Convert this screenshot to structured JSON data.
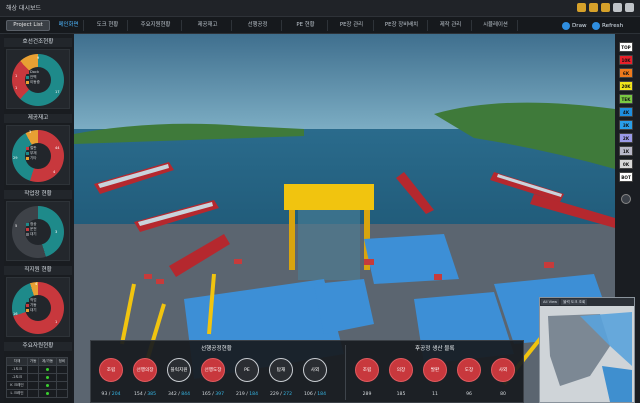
{
  "app": {
    "title": "해상 대시보드"
  },
  "nav": {
    "project_button": "Project List",
    "tabs": [
      "메인화면",
      "도크 현황",
      "주요지원현황",
      "제공재고",
      "선행공정",
      "PE 현황",
      "PE장 관리",
      "PE장 장비배치",
      "제작 관리",
      "시뮬레이션"
    ],
    "active_tab_index": 0,
    "draw_label": "Draw",
    "refresh_label": "Refresh"
  },
  "left_panels": {
    "p1": {
      "title": "호선건조현황",
      "legend": [
        "Dock",
        "안벽",
        "이동중"
      ],
      "values": [
        "1",
        "9",
        "1",
        "17"
      ]
    },
    "p2": {
      "title": "제공재고",
      "legend": [
        "철판",
        "부재",
        "기타"
      ],
      "values": [
        "3",
        "44",
        "29",
        "4"
      ]
    },
    "p3": {
      "title": "작업장 현황",
      "legend": [
        "정상",
        "운전",
        "대기"
      ],
      "values": [
        "5",
        "3"
      ]
    },
    "p4": {
      "title": "직지원 현황",
      "legend": [
        "작업",
        "가동",
        "대기"
      ],
      "values": [
        "4",
        "16",
        "1"
      ]
    },
    "table": {
      "title": "주요자원현황",
      "headers": [
        "자재",
        "가동",
        "계/가동",
        "정비"
      ],
      "rows": [
        [
          "-1도크",
          "",
          "",
          ""
        ],
        [
          "-2도크",
          "",
          "",
          ""
        ],
        [
          "K 크레인",
          "",
          "",
          ""
        ],
        [
          "L 크레인",
          "",
          "",
          ""
        ],
        [
          "골리앗",
          "",
          "",
          ""
        ]
      ]
    }
  },
  "levels": [
    "TOP",
    "10K",
    "6K",
    "20K",
    "TEK",
    "4K",
    "3K",
    "2K",
    "1K",
    "0K",
    "BOT"
  ],
  "level_colors": [
    "#ffffff",
    "#e8202a",
    "#f07a1c",
    "#f2e41c",
    "#7ac943",
    "#1e8fe0",
    "#2a9fe8",
    "#9a9ae8",
    "#b8b8c8",
    "#d8d8d8",
    "#ffffff"
  ],
  "bottom": {
    "left": {
      "title": "선행공정현황",
      "items": [
        {
          "label": "조립",
          "done": "93",
          "total": "204"
        },
        {
          "label": "선행의장",
          "done": "154",
          "total": "385"
        },
        {
          "label": "블럭지원",
          "done": "342",
          "total": "844"
        },
        {
          "label": "선행도장",
          "done": "165",
          "total": "397"
        },
        {
          "label": "PE",
          "done": "219",
          "total": "184"
        },
        {
          "label": "탑재",
          "done": "229",
          "total": "272"
        },
        {
          "label": "사외",
          "done": "106",
          "total": "184"
        }
      ]
    },
    "right": {
      "title": "후공정 생산 블록",
      "items": [
        {
          "label": "조립",
          "value": "289"
        },
        {
          "label": "의장",
          "value": "185"
        },
        {
          "label": "발판",
          "value": "11"
        },
        {
          "label": "도장",
          "value": "96"
        },
        {
          "label": "사외",
          "value": "80"
        }
      ]
    }
  },
  "minimap": {
    "tabs": [
      "All View",
      "블럭 도크 조회"
    ]
  }
}
